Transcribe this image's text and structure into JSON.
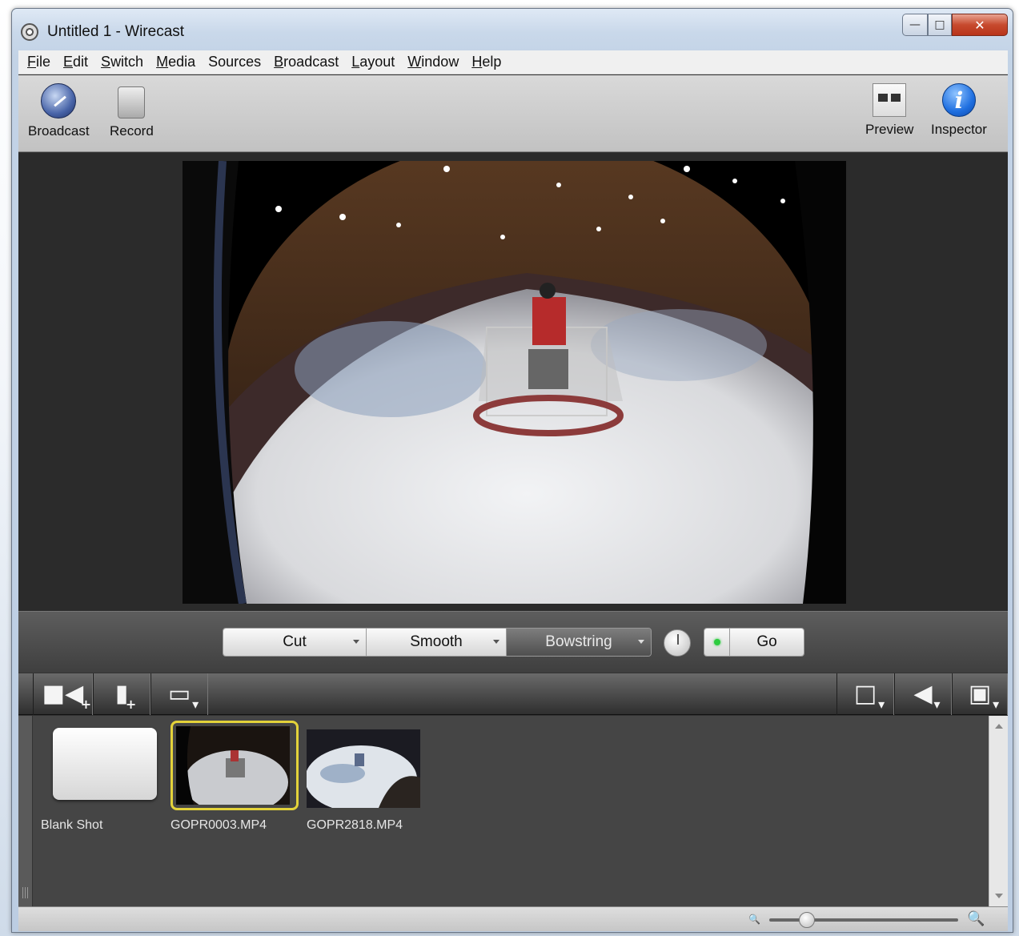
{
  "window": {
    "title": "Untitled 1 - Wirecast"
  },
  "menu": [
    "File",
    "Edit",
    "Switch",
    "Media",
    "Sources",
    "Broadcast",
    "Layout",
    "Window",
    "Help"
  ],
  "toolbar": {
    "broadcast_label": "Broadcast",
    "record_label": "Record",
    "preview_label": "Preview",
    "inspector_label": "Inspector"
  },
  "transitions": {
    "items": [
      {
        "label": "Cut",
        "selected": false
      },
      {
        "label": "Smooth",
        "selected": false
      },
      {
        "label": "Bowstring",
        "selected": true
      }
    ],
    "go_label": "Go",
    "go_indicator_color": "#2ecc40"
  },
  "layer_toolbar": {
    "left_icons": [
      "add-camera-icon",
      "add-media-file-icon",
      "add-desktop-icon"
    ],
    "right_icons": [
      "shot-layout-icon",
      "audio-icon",
      "layer-view-icon"
    ]
  },
  "shots": [
    {
      "label": "Blank Shot",
      "selected": false
    },
    {
      "label": "GOPR0003.MP4",
      "selected": true
    },
    {
      "label": "GOPR2818.MP4",
      "selected": false
    }
  ],
  "zoom": {
    "value": 0.2
  },
  "colors": {
    "selection_border": "#e3d23a",
    "live_indicator": "#2ecc40"
  }
}
